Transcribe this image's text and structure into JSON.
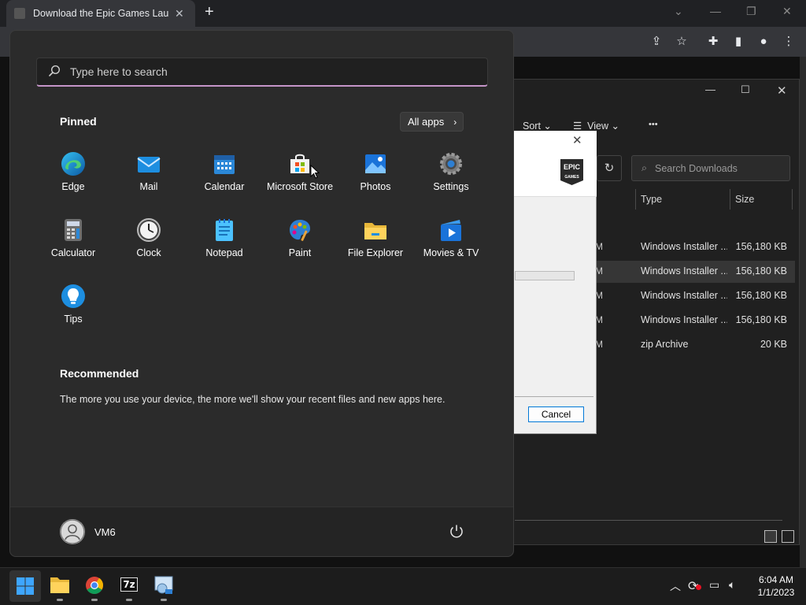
{
  "browser": {
    "tab_title": "Download the Epic Games Launc",
    "tab_close": "✕",
    "new_tab": "+"
  },
  "explorer": {
    "command_sort": "Sort",
    "command_view": "View",
    "command_more": "•••",
    "search_placeholder": "Search Downloads",
    "columns": [
      "Type",
      "Size"
    ],
    "rows": [
      {
        "m": "M",
        "type": "Windows Installer ...",
        "size": "156,180 KB",
        "selected": false
      },
      {
        "m": "M",
        "type": "Windows Installer ...",
        "size": "156,180 KB",
        "selected": true
      },
      {
        "m": "M",
        "type": "Windows Installer ...",
        "size": "156,180 KB",
        "selected": false
      },
      {
        "m": "M",
        "type": "Windows Installer ...",
        "size": "156,180 KB",
        "selected": false
      },
      {
        "m": "M",
        "type": "zip Archive",
        "size": "20 KB",
        "selected": false
      }
    ]
  },
  "installer": {
    "logo_line1": "EPIC",
    "logo_line2": "GAMES",
    "cancel_label": "Cancel"
  },
  "start_menu": {
    "search_placeholder": "Type here to search",
    "pinned_title": "Pinned",
    "all_apps_label": "All apps",
    "pinned_apps": [
      "Edge",
      "Mail",
      "Calendar",
      "Microsoft Store",
      "Photos",
      "Settings",
      "Calculator",
      "Clock",
      "Notepad",
      "Paint",
      "File Explorer",
      "Movies & TV",
      "Tips"
    ],
    "recommended_title": "Recommended",
    "recommended_text": "The more you use your device, the more we'll show your recent files and new apps here.",
    "user_name": "VM6"
  },
  "taskbar": {
    "seven_zip_label": "7z",
    "time": "6:04 AM",
    "date": "1/1/2023"
  },
  "colors": {
    "start_bg": "#2b2b2b",
    "search_accent": "#c595c9",
    "taskbar_bg": "#1c1c1c",
    "explorer_bg": "#202020",
    "cancel_border": "#0078d7"
  }
}
